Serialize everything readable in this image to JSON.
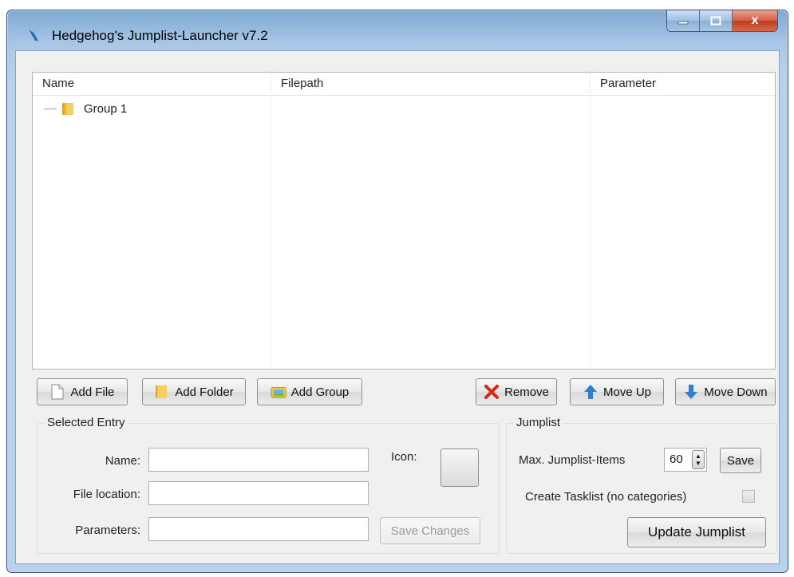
{
  "window": {
    "title": "Hedgehog's Jumplist-Launcher v7.2",
    "close_glyph": "x"
  },
  "tree": {
    "columns": [
      "Name",
      "Filepath",
      "Parameter"
    ],
    "rows": [
      {
        "label": "Group 1",
        "icon": "folder-icon"
      }
    ]
  },
  "toolbar": {
    "add_file": "Add File",
    "add_folder": "Add Folder",
    "add_group": "Add Group",
    "remove": "Remove",
    "move_up": "Move Up",
    "move_down": "Move Down"
  },
  "selected_entry": {
    "title": "Selected Entry",
    "name_label": "Name:",
    "file_location_label": "File location:",
    "parameters_label": "Parameters:",
    "icon_label": "Icon:",
    "name_value": "",
    "file_location_value": "",
    "parameters_value": "",
    "save_changes": "Save Changes"
  },
  "jumplist": {
    "title": "Jumplist",
    "max_items_label": "Max. Jumplist-Items",
    "max_items_value": "60",
    "save": "Save",
    "tasklist_label": "Create Tasklist (no categories)",
    "tasklist_checked": false,
    "update": "Update Jumplist"
  },
  "colors": {
    "remove_icon": "#d42a16",
    "move_icon": "#2f7fd4",
    "folder": "#e8b93a"
  }
}
